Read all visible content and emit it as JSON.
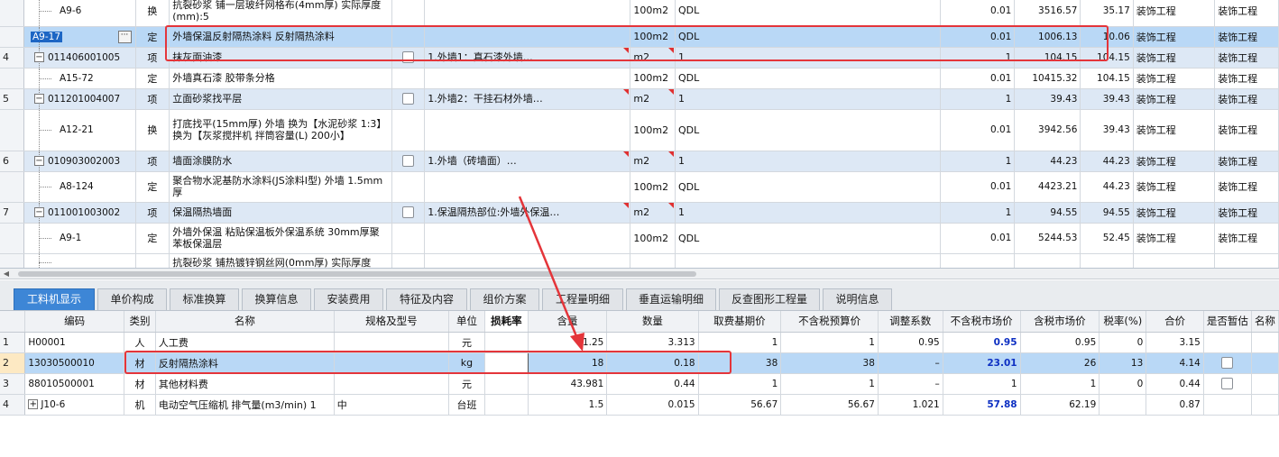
{
  "upper": {
    "rows": [
      {
        "kind": "child",
        "idx": "",
        "code": "A9-6",
        "type": "换",
        "name": "抗裂砂浆 铺一层玻纤网格布(4mm厚) 实际厚度(mm):5",
        "feature": "",
        "unit": "100m2",
        "expr": "QDL",
        "qty": "0.01",
        "price": "3516.57",
        "total": "35.17",
        "spec": "装饰工程",
        "spec2": "装饰工程"
      },
      {
        "kind": "sel",
        "idx": "",
        "code": "A9-17",
        "type": "定",
        "name": "外墙保温反射隔热涂料 反射隔热涂料",
        "feature": "",
        "unit": "100m2",
        "expr": "QDL",
        "qty": "0.01",
        "price": "1006.13",
        "total": "10.06",
        "spec": "装饰工程",
        "spec2": "装饰工程"
      },
      {
        "kind": "item",
        "idx": "4",
        "code": "011406001005",
        "type": "项",
        "name": "抹灰面油漆",
        "feature": "1.外墙1：真石漆外墙…",
        "unit": "m2",
        "expr": "1",
        "qty": "1",
        "price": "104.15",
        "total": "104.15",
        "spec": "装饰工程",
        "spec2": "装饰工程"
      },
      {
        "kind": "child",
        "idx": "",
        "code": "A15-72",
        "type": "定",
        "name": "外墙真石漆 胶带条分格",
        "feature": "",
        "unit": "100m2",
        "expr": "QDL",
        "qty": "0.01",
        "price": "10415.32",
        "total": "104.15",
        "spec": "装饰工程",
        "spec2": "装饰工程"
      },
      {
        "kind": "item",
        "idx": "5",
        "code": "011201004007",
        "type": "项",
        "name": "立面砂浆找平层",
        "feature": "1.外墙2：干挂石材外墙…",
        "unit": "m2",
        "expr": "1",
        "qty": "1",
        "price": "39.43",
        "total": "39.43",
        "spec": "装饰工程",
        "spec2": "装饰工程"
      },
      {
        "kind": "child",
        "idx": "",
        "code": "A12-21",
        "type": "换",
        "name": "打底找平(15mm厚) 外墙  换为【水泥砂浆 1:3】  换为【灰浆搅拌机 拌筒容量(L) 200小】",
        "feature": "",
        "unit": "100m2",
        "expr": "QDL",
        "qty": "0.01",
        "price": "3942.56",
        "total": "39.43",
        "spec": "装饰工程",
        "spec2": "装饰工程"
      },
      {
        "kind": "item",
        "idx": "6",
        "code": "010903002003",
        "type": "项",
        "name": "墙面涂膜防水",
        "feature": "1.外墙（砖墙面）…",
        "unit": "m2",
        "expr": "1",
        "qty": "1",
        "price": "44.23",
        "total": "44.23",
        "spec": "装饰工程",
        "spec2": "装饰工程"
      },
      {
        "kind": "child",
        "idx": "",
        "code": "A8-124",
        "type": "定",
        "name": "聚合物水泥基防水涂料(JS涂料I型) 外墙 1.5mm厚",
        "feature": "",
        "unit": "100m2",
        "expr": "QDL",
        "qty": "0.01",
        "price": "4423.21",
        "total": "44.23",
        "spec": "装饰工程",
        "spec2": "装饰工程"
      },
      {
        "kind": "item",
        "idx": "7",
        "code": "011001003002",
        "type": "项",
        "name": "保温隔热墙面",
        "feature": "1.保温隔热部位:外墙外保温…",
        "unit": "m2",
        "expr": "1",
        "qty": "1",
        "price": "94.55",
        "total": "94.55",
        "spec": "装饰工程",
        "spec2": "装饰工程"
      },
      {
        "kind": "child",
        "idx": "",
        "code": "A9-1",
        "type": "定",
        "name": "外墙外保温 粘贴保温板外保温系统 30mm厚聚苯板保温层",
        "feature": "",
        "unit": "100m2",
        "expr": "QDL",
        "qty": "0.01",
        "price": "5244.53",
        "total": "52.45",
        "spec": "装饰工程",
        "spec2": "装饰工程"
      },
      {
        "kind": "child",
        "idx": "",
        "code": "",
        "type": "",
        "name": "抗裂砂浆 铺热镀锌钢丝网(0mm厚) 实际厚度",
        "feature": "",
        "unit": "",
        "expr": "",
        "qty": "",
        "price": "",
        "total": "",
        "spec": "",
        "spec2": ""
      }
    ]
  },
  "tabs": [
    "工料机显示",
    "单价构成",
    "标准换算",
    "换算信息",
    "安装费用",
    "特征及内容",
    "组价方案",
    "工程量明细",
    "垂直运输明细",
    "反查图形工程量",
    "说明信息"
  ],
  "lower": {
    "headers": [
      "",
      "编码",
      "类别",
      "名称",
      "规格及型号",
      "单位",
      "损耗率",
      "含量",
      "数量",
      "取费基期价",
      "不含税预算价",
      "调整系数",
      "不含税市场价",
      "含税市场价",
      "税率(%)",
      "合价",
      "是否暂估",
      "名称"
    ],
    "rows": [
      {
        "idx": "1",
        "code": "H00001",
        "cat": "人",
        "name": "人工费",
        "spec": "",
        "unit": "元",
        "loss": "",
        "content": "1.25",
        "qty": "3.313",
        "base": "1",
        "budget": "1",
        "coef": "0.95",
        "market": "0.95",
        "taxmarket": "0.95",
        "tax": "0",
        "total": "3.15",
        "temp": false
      },
      {
        "idx": "2",
        "code": "13030500010",
        "cat": "材",
        "name": "反射隔热涂料",
        "spec": "",
        "unit": "kg",
        "loss": "",
        "content": "18",
        "qty": "0.18",
        "base": "38",
        "budget": "38",
        "coef": "–",
        "market": "23.01",
        "taxmarket": "26",
        "tax": "13",
        "total": "4.14",
        "temp": true
      },
      {
        "idx": "3",
        "code": "88010500001",
        "cat": "材",
        "name": "其他材料费",
        "spec": "",
        "unit": "元",
        "loss": "",
        "content": "43.981",
        "qty": "0.44",
        "base": "1",
        "budget": "1",
        "coef": "–",
        "market": "1",
        "taxmarket": "1",
        "tax": "0",
        "total": "0.44",
        "temp": true
      },
      {
        "idx": "4",
        "code": "J10-6",
        "cat": "机",
        "name": "电动空气压缩机 排气量(m3/min) 1",
        "spec": "中",
        "unit": "台班",
        "loss": "",
        "content": "1.5",
        "qty": "0.015",
        "base": "56.67",
        "budget": "56.67",
        "coef": "1.021",
        "market": "57.88",
        "taxmarket": "62.19",
        "tax": "",
        "total": "0.87",
        "temp": false
      }
    ]
  },
  "colors": {
    "accent": "#3d86d6",
    "selected_row": "#b9d8f6",
    "item_row": "#dde8f5",
    "annotation": "#e4353a",
    "market_value": "#0d2fc2"
  },
  "icons": {
    "expander": "minus-box-icon",
    "more": "ellipsis-icon",
    "expand_plus": "plus-box-icon"
  }
}
